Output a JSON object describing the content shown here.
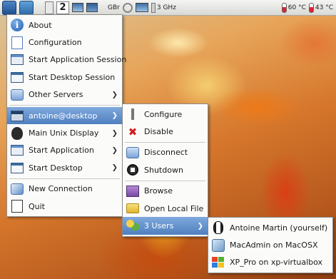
{
  "panel": {
    "workspace_active": "2",
    "network_label": "GBr",
    "cpu_freq": "3 GHz",
    "temp1": "60 °C",
    "temp2": "43 °C"
  },
  "main_menu": {
    "items": [
      {
        "label": "About",
        "icon": "info-icon"
      },
      {
        "label": "Configuration",
        "icon": "configuration-icon"
      },
      {
        "label": "Start Application Session",
        "icon": "application-session-icon"
      },
      {
        "label": "Start Desktop Session",
        "icon": "desktop-session-icon"
      },
      {
        "label": "Other Servers",
        "icon": "network-servers-icon",
        "submenu": true
      },
      {
        "label": "antoine@desktop",
        "icon": "server-icon",
        "submenu": true,
        "selected": true
      },
      {
        "label": "Main Unix Display",
        "icon": "gnome-foot-icon",
        "submenu": true
      },
      {
        "label": "Start Application",
        "icon": "start-application-icon",
        "submenu": true
      },
      {
        "label": "Start Desktop",
        "icon": "start-desktop-icon",
        "submenu": true
      },
      {
        "label": "New Connection",
        "icon": "new-connection-icon"
      },
      {
        "label": "Quit",
        "icon": "quit-icon"
      }
    ]
  },
  "server_menu": {
    "items": [
      {
        "label": "Configure",
        "icon": "configure-icon"
      },
      {
        "label": "Disable",
        "icon": "disable-icon"
      },
      {
        "label": "Disconnect",
        "icon": "disconnect-icon"
      },
      {
        "label": "Shutdown",
        "icon": "shutdown-icon"
      },
      {
        "label": "Browse",
        "icon": "browse-icon"
      },
      {
        "label": "Open Local File",
        "icon": "folder-icon"
      },
      {
        "label": "3 Users",
        "icon": "users-icon",
        "submenu": true,
        "selected": true
      }
    ]
  },
  "users_menu": {
    "items": [
      {
        "label": "Antoine Martin (yourself)",
        "icon": "linux-tux-icon"
      },
      {
        "label": "MacAdmin on MacOSX",
        "icon": "macos-icon"
      },
      {
        "label": "XP_Pro on xp-virtualbox",
        "icon": "windows-xp-icon"
      }
    ]
  },
  "colors": {
    "selection": "#5b88c6",
    "menu_bg": "#fbfbfa",
    "panel_bg": "#e6e6e3"
  }
}
